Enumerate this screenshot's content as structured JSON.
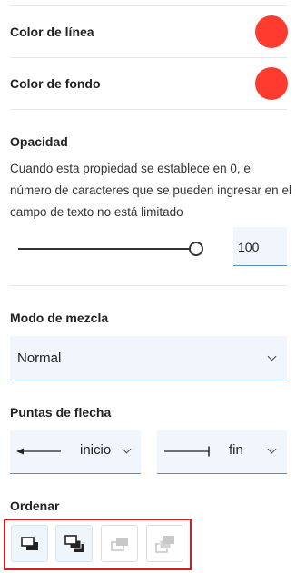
{
  "line_color": {
    "label": "Color de línea",
    "value": "#ff3b30"
  },
  "fill_color": {
    "label": "Color de fondo",
    "value": "#ff3b30"
  },
  "opacity": {
    "title": "Opacidad",
    "description": "Cuando esta propiedad se establece en 0, el número de caracteres que se pueden ingresar en el campo de texto no está limitado",
    "value": "100",
    "slider_level": 1.0
  },
  "blend_mode": {
    "title": "Modo de mezcla",
    "selected": "Normal"
  },
  "arrowheads": {
    "title": "Puntas de flecha",
    "start": {
      "selected": "inicio",
      "icon": "arrow-left-icon"
    },
    "end": {
      "selected": "fin",
      "icon": "line-bar-end-icon"
    }
  },
  "order": {
    "title": "Ordenar",
    "buttons": [
      {
        "name": "bring-forward",
        "icon": "bring-forward-icon",
        "enabled": true
      },
      {
        "name": "bring-to-front",
        "icon": "bring-to-front-icon",
        "enabled": true
      },
      {
        "name": "send-backward",
        "icon": "send-backward-icon",
        "enabled": false
      },
      {
        "name": "send-to-back",
        "icon": "send-to-back-icon",
        "enabled": false
      }
    ],
    "highlight_color": "#e0191f"
  }
}
